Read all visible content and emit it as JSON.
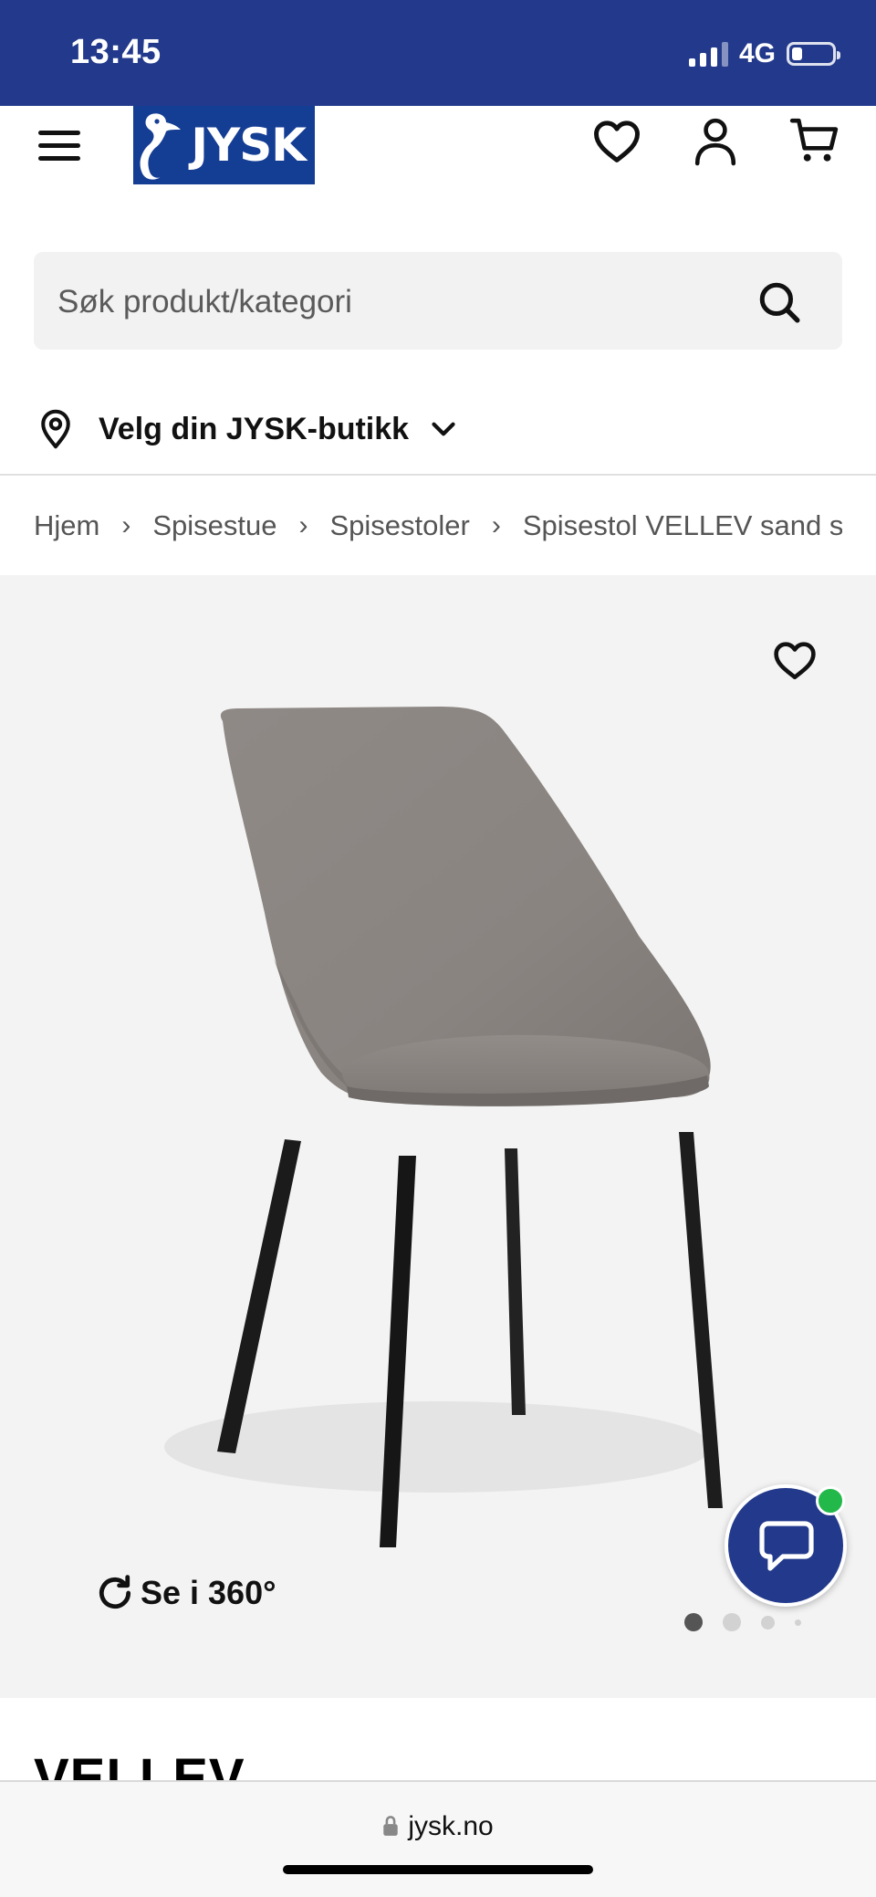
{
  "status": {
    "time": "13:45",
    "network": "4G",
    "battery_level": 0.25
  },
  "header": {
    "logo_text": "JYSK"
  },
  "search": {
    "placeholder": "Søk produkt/kategori"
  },
  "store": {
    "label": "Velg din JYSK-butikk"
  },
  "breadcrumb": [
    "Hjem",
    "Spisestue",
    "Spisestoler",
    "Spisestol VELLEV sand stoff"
  ],
  "gallery": {
    "see360_label": "Se i 360°",
    "image_count": 4,
    "active_index": 0
  },
  "product": {
    "title": "VELLEV"
  },
  "browser": {
    "url": "jysk.no"
  },
  "colors": {
    "brand_blue": "#233a8c",
    "logo_blue": "#143d94",
    "online_green": "#22b84a"
  }
}
